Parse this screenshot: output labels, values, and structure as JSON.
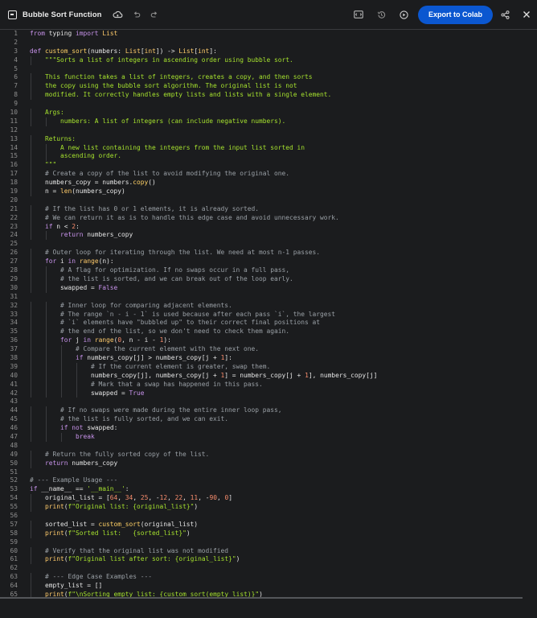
{
  "header": {
    "title": "Bubble Sort Function",
    "export_label": "Export to Colab"
  },
  "icons": {
    "app": "notebook-icon",
    "cloud": "cloud-icon",
    "undo": "undo-icon",
    "redo": "redo-icon",
    "code": "code-view-icon",
    "history": "history-icon",
    "run": "run-icon",
    "share": "share-icon",
    "close": "close-icon"
  },
  "colors": {
    "background": "#1b1c1e",
    "accent": "#0b57d0",
    "keyword": "#c792ea",
    "function": "#ffd166",
    "string": "#a6e22e",
    "comment": "#9aa0a6"
  },
  "code": {
    "language": "python",
    "lines": [
      "from typing import List",
      "",
      "def custom_sort(numbers: List[int]) -> List[int]:",
      "    \"\"\"Sorts a list of integers in ascending order using bubble sort.",
      "",
      "    This function takes a list of integers, creates a copy, and then sorts",
      "    the copy using the bubble sort algorithm. The original list is not",
      "    modified. It correctly handles empty lists and lists with a single element.",
      "",
      "    Args:",
      "        numbers: A list of integers (can include negative numbers).",
      "",
      "    Returns:",
      "        A new list containing the integers from the input list sorted in",
      "        ascending order.",
      "    \"\"\"",
      "    # Create a copy of the list to avoid modifying the original one.",
      "    numbers_copy = numbers.copy()",
      "    n = len(numbers_copy)",
      "",
      "    # If the list has 0 or 1 elements, it is already sorted.",
      "    # We can return it as is to handle this edge case and avoid unnecessary work.",
      "    if n < 2:",
      "        return numbers_copy",
      "",
      "    # Outer loop for iterating through the list. We need at most n-1 passes.",
      "    for i in range(n):",
      "        # A flag for optimization. If no swaps occur in a full pass,",
      "        # the list is sorted, and we can break out of the loop early.",
      "        swapped = False",
      "",
      "        # Inner loop for comparing adjacent elements.",
      "        # The range `n - i - 1` is used because after each pass `i`, the largest",
      "        # `i` elements have \"bubbled up\" to their correct final positions at",
      "        # the end of the list, so we don't need to check them again.",
      "        for j in range(0, n - i - 1):",
      "            # Compare the current element with the next one.",
      "            if numbers_copy[j] > numbers_copy[j + 1]:",
      "                # If the current element is greater, swap them.",
      "                numbers_copy[j], numbers_copy[j + 1] = numbers_copy[j + 1], numbers_copy[j]",
      "                # Mark that a swap has happened in this pass.",
      "                swapped = True",
      "",
      "        # If no swaps were made during the entire inner loop pass,",
      "        # the list is fully sorted, and we can exit.",
      "        if not swapped:",
      "            break",
      "",
      "    # Return the fully sorted copy of the list.",
      "    return numbers_copy",
      "",
      "# --- Example Usage ---",
      "if __name__ == '__main__':",
      "    original_list = [64, 34, 25, -12, 22, 11, -90, 0]",
      "    print(f\"Original list: {original_list}\")",
      "",
      "    sorted_list = custom_sort(original_list)",
      "    print(f\"Sorted list:   {sorted_list}\")",
      "",
      "    # Verify that the original list was not modified",
      "    print(f\"Original list after sort: {original_list}\")",
      "",
      "    # --- Edge Case Examples ---",
      "    empty_list = []",
      "    print(f\"\\nSorting empty list: {custom_sort(empty_list)}\")"
    ]
  }
}
